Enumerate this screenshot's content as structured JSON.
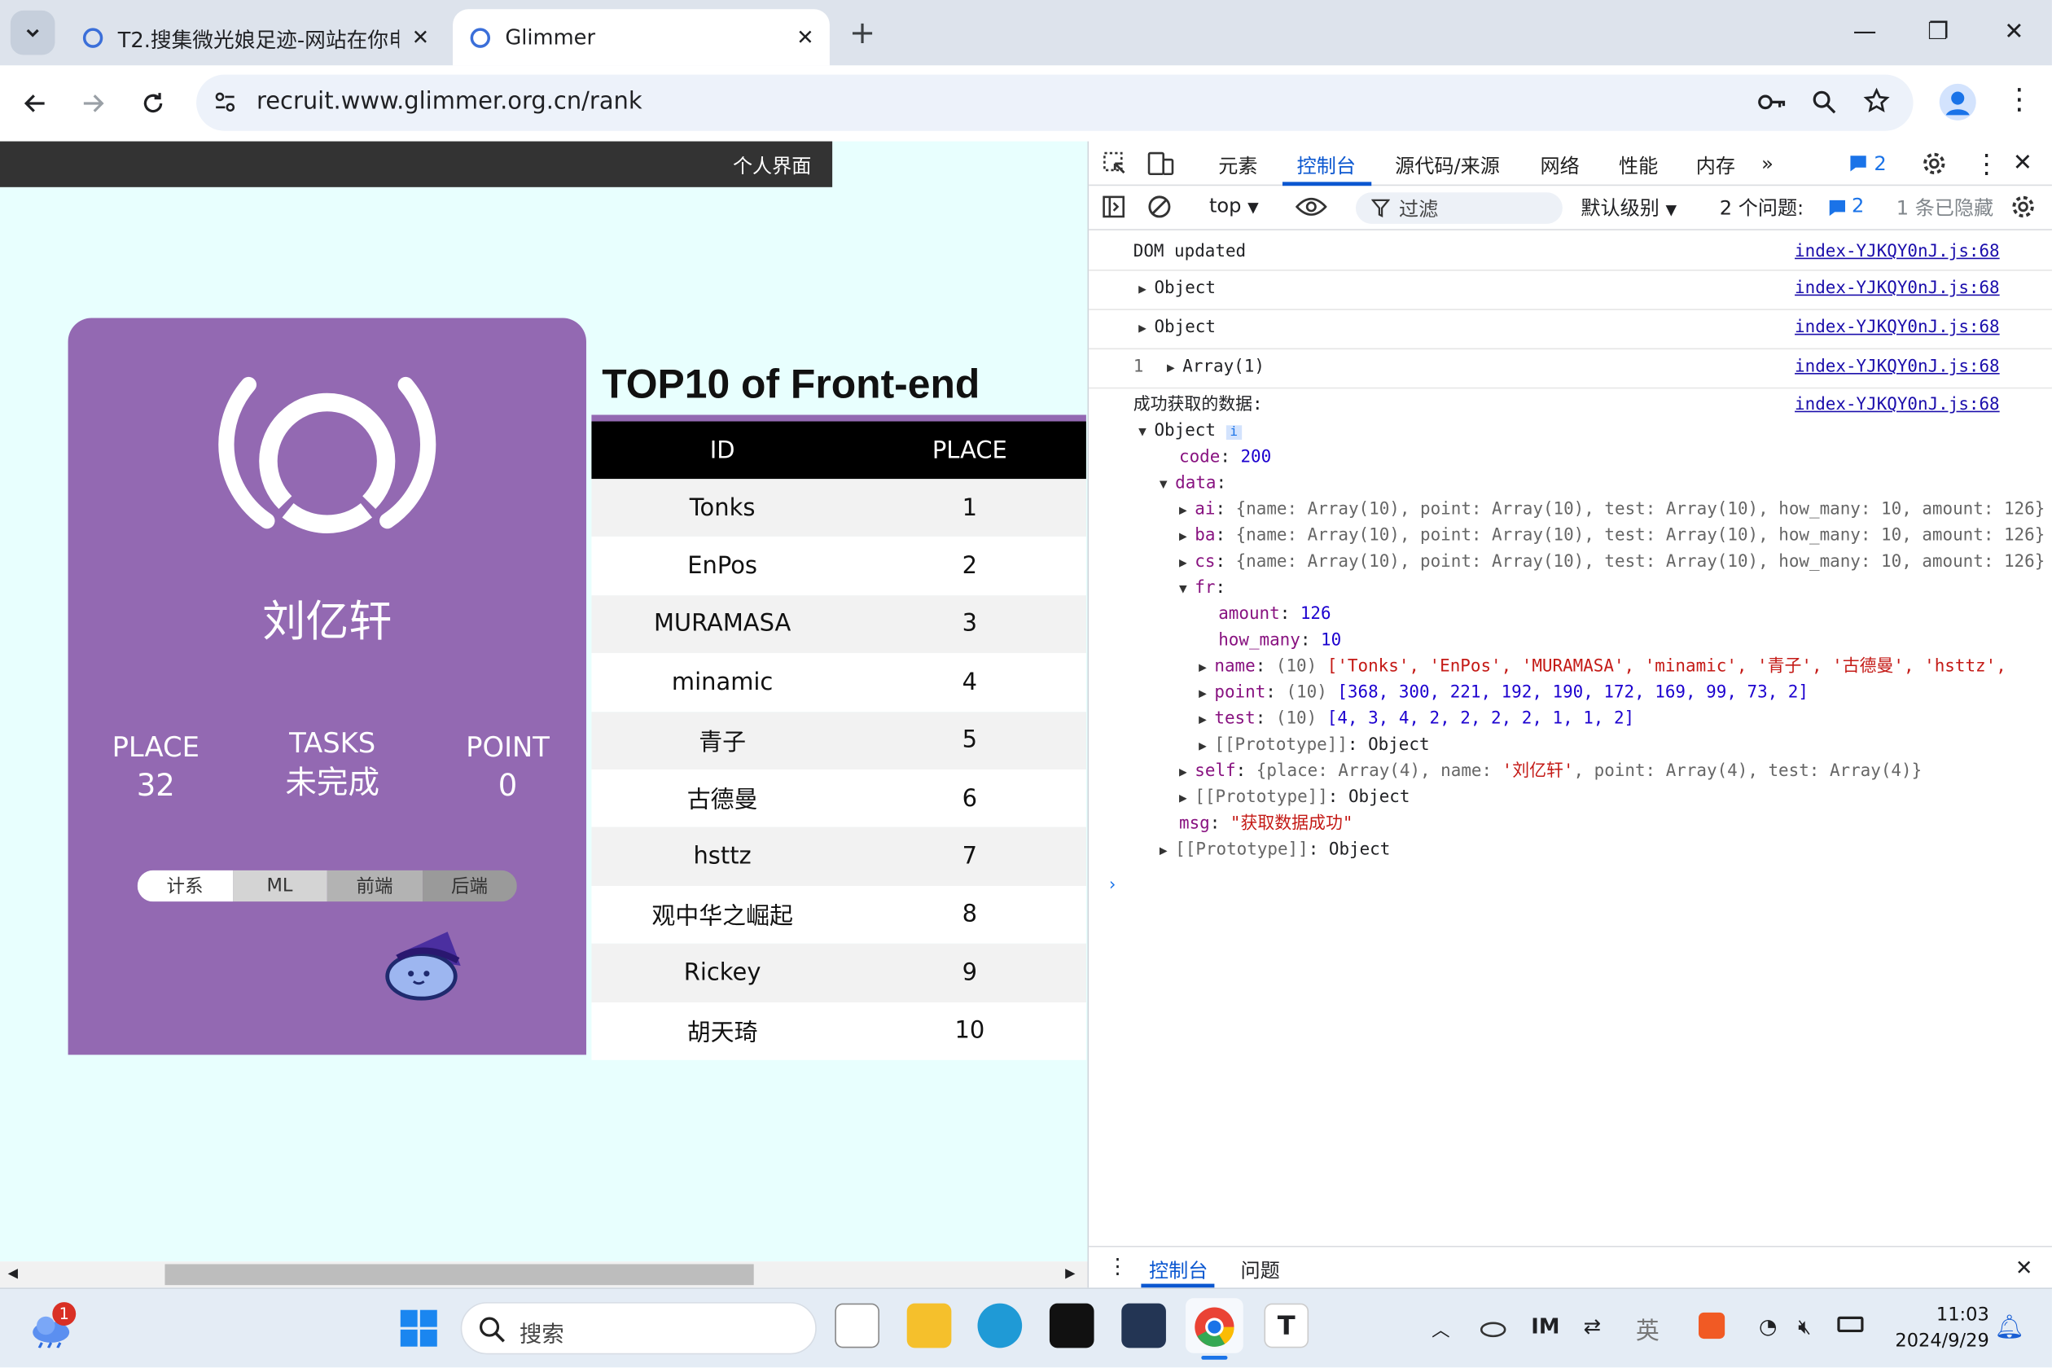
{
  "browser": {
    "tabs": [
      {
        "title": "T2.搜集微光娘足迹-网站在你电",
        "active": false
      },
      {
        "title": "Glimmer",
        "active": true
      }
    ],
    "url": "recruit.www.glimmer.org.cn/rank"
  },
  "page": {
    "topbar_link": "个人界面",
    "profile": {
      "name": "刘亿轩",
      "stats": [
        {
          "label": "PLACE",
          "value": "32"
        },
        {
          "label": "TASKS",
          "value": "未完成"
        },
        {
          "label": "POINT",
          "value": "0"
        }
      ],
      "segments": [
        "计系",
        "ML",
        "前端",
        "后端"
      ],
      "selected_segment": "计系"
    },
    "ranking": {
      "title": "TOP10 of Front-end",
      "columns": [
        "ID",
        "PLACE"
      ],
      "rows": [
        [
          "Tonks",
          "1"
        ],
        [
          "EnPos",
          "2"
        ],
        [
          "MURAMASA",
          "3"
        ],
        [
          "minamic",
          "4"
        ],
        [
          "青子",
          "5"
        ],
        [
          "古德曼",
          "6"
        ],
        [
          "hsttz",
          "7"
        ],
        [
          "观中华之崛起",
          "8"
        ],
        [
          "Rickey",
          "9"
        ],
        [
          "胡天琦",
          "10"
        ]
      ]
    }
  },
  "devtools": {
    "tabs": [
      "元素",
      "控制台",
      "源代码/来源",
      "网络",
      "性能",
      "内存"
    ],
    "active_tab": "控制台",
    "issues_badge": "2",
    "context": "top",
    "filter_placeholder": "过滤",
    "level": "默认级别",
    "issues_text": "2 个问题:",
    "issues_count": "2",
    "hidden_text": "1 条已隐藏",
    "source": "index-YJKQY0nJ.js:68",
    "drawer_tabs": [
      "控制台",
      "问题"
    ]
  },
  "console": {
    "l0": "DOM updated",
    "l1": "Object",
    "l2": "Object",
    "l3_count": "1",
    "l3": "Array(1)",
    "l4": "成功获取的数据:",
    "l5": "Object",
    "code": "200",
    "amount": "126",
    "how_many": "10",
    "data_summary": "{name: Array(10), point: Array(10), test: Array(10), how_many: 10, amount: 126}",
    "name_list": "['Tonks', 'EnPos', 'MURAMASA', 'minamic', '青子', '古德曼', 'hsttz',",
    "point_list": "[368, 300, 221, 192, 190, 172, 169, 99, 73, 2]",
    "test_list": "[4, 3, 4, 2, 2, 2, 2, 1, 1, 2]",
    "self_summary_a": "{place: Array(4), name: ",
    "self_name": "'刘亿轩'",
    "self_summary_b": ", point: Array(4), test: Array(4)}",
    "msg": "\"获取数据成功\"",
    "proto": "[[Prototype]]",
    "proto_val": "Object",
    "len10": "(10)"
  },
  "taskbar": {
    "search_placeholder": "搜索",
    "time": "11:03",
    "date": "2024/9/29",
    "weather_badge": "1",
    "ime": "英"
  },
  "colors": {
    "card": "#9369b2",
    "page_bg": "#e8fffe",
    "accent": "#1a73e8"
  }
}
